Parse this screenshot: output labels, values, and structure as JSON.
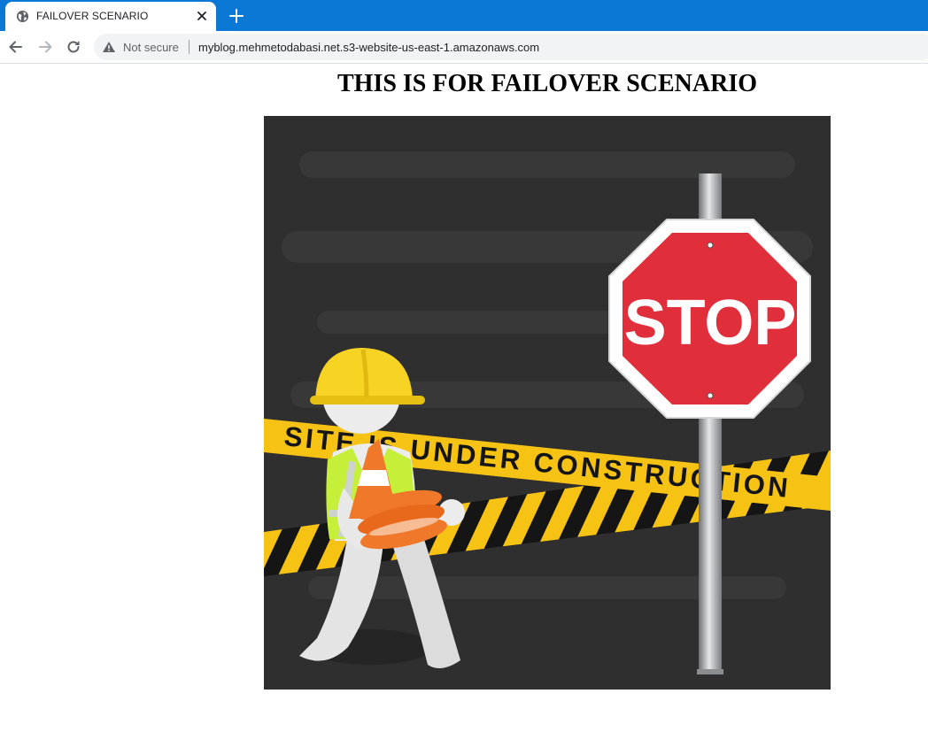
{
  "browser": {
    "tab": {
      "title": "FAILOVER SCENARIO",
      "favicon": "globe-icon"
    },
    "new_tab_icon": "plus-icon",
    "close_icon": "close-icon",
    "nav": {
      "back_icon": "back-arrow-icon",
      "forward_icon": "forward-arrow-icon",
      "reload_icon": "reload-icon"
    },
    "address_bar": {
      "security_icon": "warning-icon",
      "security_label": "Not secure",
      "url": "myblog.mehmetodabasi.net.s3-website-us-east-1.amazonaws.com"
    },
    "colors": {
      "tab_strip": "#0a78d4",
      "omnibox": "#f1f3f4"
    }
  },
  "page": {
    "heading": "THIS IS FOR FAILOVER SCENARIO",
    "illustration": {
      "sign_text": "STOP",
      "tape_text": "SITE IS UNDER CONSTRUCTION",
      "colors": {
        "background": "#2f2f2f",
        "tape": "#f6c214",
        "sign": "#e02f3b",
        "helmet": "#f7d323",
        "vest": "#c6ef3a",
        "cone": "#f0782a"
      }
    }
  }
}
